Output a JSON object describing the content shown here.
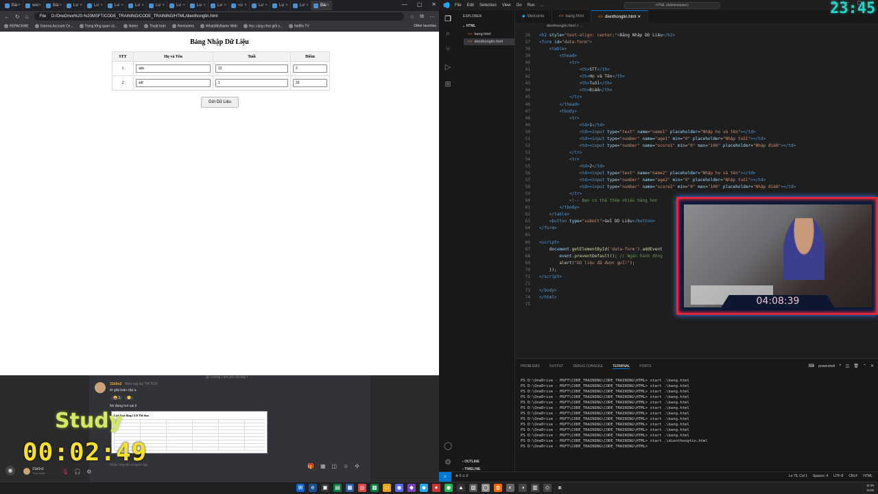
{
  "browser": {
    "tabs": [
      {
        "label": "Bài"
      },
      {
        "label": "wei"
      },
      {
        "label": "Bài"
      },
      {
        "label": "Lư"
      },
      {
        "label": "Lư"
      },
      {
        "label": "Lư"
      },
      {
        "label": "Lư"
      },
      {
        "label": "Lư"
      },
      {
        "label": "Lư"
      },
      {
        "label": "Lư"
      },
      {
        "label": "Lư"
      },
      {
        "label": "<o"
      },
      {
        "label": "Lư"
      },
      {
        "label": "Lư"
      },
      {
        "label": "Lư"
      },
      {
        "label": "Bài"
      }
    ],
    "file_chip": "File",
    "url": "D:/OneDrive%20-%20MSFT/CODE_TRAINING/CODE_TRAINING/HTML/dienthongtin.html",
    "bookmarks": [
      "REPACKME",
      "Garena Account Ce...",
      "Trang tổng quan củ...",
      "Notes",
      "Thuật toán",
      "Reminders",
      "WhatsMyName Web",
      "Học cùng chơi giỏi s...",
      "Netflix TV"
    ],
    "other_favorites": "Other favorites"
  },
  "page": {
    "title": "Bảng Nhập Dữ Liệu",
    "headers": [
      "STT",
      "Họ và Tên",
      "Tuổi",
      "Điểm"
    ],
    "rows": [
      {
        "stt": "1",
        "name": "ads",
        "age": "12",
        "score": "2"
      },
      {
        "stt": "2",
        "name": "sdf",
        "age": "1",
        "score": "33"
      }
    ],
    "submit_label": "Gửi Dữ Liệu"
  },
  "overlay": {
    "chat_cut": "@ Lường Làm pro cái này r",
    "chat_user": "31b0n3",
    "chat_time": "Hôm nay lúc TH:TCH",
    "chat_msg1": "tớ giải toán cậu a",
    "reactions": [
      "😄 1",
      "😁"
    ],
    "chat_msg2": "Nó đang hơi sai tí",
    "chat_img_title": "Lịch hoạt động CLB Thể thao",
    "chat_input_placeholder": "Nhắn #ng-đố-chuyên-tập",
    "study_label": "Study",
    "study_clock": "00:02:49",
    "bottom_user": "31b0n3",
    "bottom_status": "Trực tuyến"
  },
  "vscode": {
    "menu": [
      "File",
      "Edit",
      "Selection",
      "View",
      "Go",
      "Run",
      "..."
    ],
    "command_center": "HTML (Administrator)",
    "explorer_title": "EXPLORER",
    "folder": "HTML",
    "files": [
      "bang.html",
      "dienthongtin.html"
    ],
    "outline": "OUTLINE",
    "timeline": "TIMELINE",
    "tabs": [
      "Welcome",
      "bang.html",
      "dienthongtin.html"
    ],
    "breadcrumb": "dienthongtin.html > ...",
    "code_lines": [
      {
        "n": "36",
        "html": "<span class='tg'>&lt;h2</span> <span class='at'>style</span>=<span class='st'>\"text-align: center;\"</span><span class='tg'>&gt;</span><span class='tx'>Bảng Nhập Dữ Liệu</span><span class='tg'>&lt;/h2&gt;</span>"
      },
      {
        "n": "37",
        "html": "<span class='tg'>&lt;form</span> <span class='at'>id</span>=<span class='st'>\"data-form\"</span><span class='tg'>&gt;</span>"
      },
      {
        "n": "38",
        "html": "    <span class='tg'>&lt;table&gt;</span>"
      },
      {
        "n": "39",
        "html": "        <span class='tg'>&lt;thead&gt;</span>"
      },
      {
        "n": "40",
        "html": "            <span class='tg'>&lt;tr&gt;</span>"
      },
      {
        "n": "41",
        "html": "                <span class='tg'>&lt;th&gt;</span><span class='tx'>STT</span><span class='tg'>&lt;/th&gt;</span>"
      },
      {
        "n": "42",
        "html": "                <span class='tg'>&lt;th&gt;</span><span class='tx'>Họ và Tên</span><span class='tg'>&lt;/th&gt;</span>"
      },
      {
        "n": "43",
        "html": "                <span class='tg'>&lt;th&gt;</span><span class='tx'>Tuổi</span><span class='tg'>&lt;/th&gt;</span>"
      },
      {
        "n": "44",
        "html": "                <span class='tg'>&lt;th&gt;</span><span class='tx'>Điểm</span><span class='tg'>&lt;/th&gt;</span>"
      },
      {
        "n": "45",
        "html": "            <span class='tg'>&lt;/tr&gt;</span>"
      },
      {
        "n": "46",
        "html": "        <span class='tg'>&lt;/thead&gt;</span>"
      },
      {
        "n": "47",
        "html": "        <span class='tg'>&lt;tbody&gt;</span>"
      },
      {
        "n": "48",
        "html": "            <span class='tg'>&lt;tr&gt;</span>"
      },
      {
        "n": "49",
        "html": "                <span class='tg'>&lt;td&gt;</span><span class='tx'>1</span><span class='tg'>&lt;/td&gt;</span>"
      },
      {
        "n": "50",
        "html": "                <span class='tg'>&lt;td&gt;&lt;input</span> <span class='at'>type</span>=<span class='st'>\"text\"</span> <span class='at'>name</span>=<span class='st'>\"name1\"</span> <span class='at'>placeholder</span>=<span class='st'>\"Nhập họ và tên\"</span><span class='tg'>&gt;&lt;/td&gt;</span>"
      },
      {
        "n": "51",
        "html": "                <span class='tg'>&lt;td&gt;&lt;input</span> <span class='at'>type</span>=<span class='st'>\"number\"</span> <span class='at'>name</span>=<span class='st'>\"age1\"</span> <span class='at'>min</span>=<span class='st'>\"0\"</span> <span class='at'>placeholder</span>=<span class='st'>\"Nhập tuổi\"</span><span class='tg'>&gt;&lt;/td&gt;</span>"
      },
      {
        "n": "52",
        "html": "                <span class='tg'>&lt;td&gt;&lt;input</span> <span class='at'>type</span>=<span class='st'>\"number\"</span> <span class='at'>name</span>=<span class='st'>\"score1\"</span> <span class='at'>min</span>=<span class='st'>\"0\"</span> <span class='at'>max</span>=<span class='st'>\"100\"</span> <span class='at'>placeholder</span>=<span class='st'>\"Nhập điểm\"</span><span class='tg'>&gt;&lt;/td&gt;</span>"
      },
      {
        "n": "53",
        "html": "            <span class='tg'>&lt;/tr&gt;</span>"
      },
      {
        "n": "54",
        "html": "            <span class='tg'>&lt;tr&gt;</span>"
      },
      {
        "n": "55",
        "html": "                <span class='tg'>&lt;td&gt;</span><span class='tx'>2</span><span class='tg'>&lt;/td&gt;</span>"
      },
      {
        "n": "56",
        "html": "                <span class='tg'>&lt;td&gt;&lt;input</span> <span class='at'>type</span>=<span class='st'>\"text\"</span> <span class='at'>name</span>=<span class='st'>\"name2\"</span> <span class='at'>placeholder</span>=<span class='st'>\"Nhập họ và tên\"</span><span class='tg'>&gt;&lt;/td&gt;</span>"
      },
      {
        "n": "57",
        "html": "                <span class='tg'>&lt;td&gt;&lt;input</span> <span class='at'>type</span>=<span class='st'>\"number\"</span> <span class='at'>name</span>=<span class='st'>\"age2\"</span> <span class='at'>min</span>=<span class='st'>\"0\"</span> <span class='at'>placeholder</span>=<span class='st'>\"Nhập tuổi\"</span><span class='tg'>&gt;&lt;/td&gt;</span>"
      },
      {
        "n": "58",
        "html": "                <span class='tg'>&lt;td&gt;&lt;input</span> <span class='at'>type</span>=<span class='st'>\"number\"</span> <span class='at'>name</span>=<span class='st'>\"score2\"</span> <span class='at'>min</span>=<span class='st'>\"0\"</span> <span class='at'>max</span>=<span class='st'>\"100\"</span> <span class='at'>placeholder</span>=<span class='st'>\"Nhập điểm\"</span><span class='tg'>&gt;&lt;/td&gt;</span>"
      },
      {
        "n": "59",
        "html": "            <span class='tg'>&lt;/tr&gt;</span>"
      },
      {
        "n": "60",
        "html": "            <span class='cm'>&lt;!-- Bạn có thể thêm nhiều hàng hơn</span>"
      },
      {
        "n": "61",
        "html": "        <span class='tg'>&lt;/tbody&gt;</span>"
      },
      {
        "n": "62",
        "html": "    <span class='tg'>&lt;/table&gt;</span>"
      },
      {
        "n": "63",
        "html": "    <span class='tg'>&lt;button</span> <span class='at'>type</span>=<span class='st'>\"submit\"</span><span class='tg'>&gt;</span><span class='tx'>Gửi Dữ Liệu</span><span class='tg'>&lt;/button&gt;</span>"
      },
      {
        "n": "64",
        "html": "<span class='tg'>&lt;/form&gt;</span>"
      },
      {
        "n": "65",
        "html": ""
      },
      {
        "n": "66",
        "html": "<span class='tg'>&lt;script&gt;</span>"
      },
      {
        "n": "67",
        "html": "    <span class='at'>document</span>.<span class='fn'>getElementById</span>(<span class='st'>'data-form'</span>).<span class='fn'>addEvent</span>"
      },
      {
        "n": "68",
        "html": "        <span class='at'>event</span>.<span class='fn'>preventDefault</span>(); <span class='cm'>// Ngăn hành động</span>"
      },
      {
        "n": "69",
        "html": "        <span class='fn'>alert</span>(<span class='st'>\"Dữ liệu đã được gửi!\"</span>);"
      },
      {
        "n": "70",
        "html": "    });"
      },
      {
        "n": "71",
        "html": "<span class='tg'>&lt;/script&gt;</span>"
      },
      {
        "n": "72",
        "html": ""
      },
      {
        "n": "73",
        "html": "<span class='tg'>&lt;/body&gt;</span>"
      },
      {
        "n": "74",
        "html": "<span class='tg'>&lt;/html&gt;</span>"
      },
      {
        "n": "75",
        "html": ""
      }
    ],
    "panel_tabs": [
      "PROBLEMS",
      "OUTPUT",
      "DEBUG CONSOLE",
      "TERMINAL",
      "PORTS"
    ],
    "panel_active": "TERMINAL",
    "shell": "powershell",
    "terminal_lines": [
      "PS D:\\OneDrive - MSFT\\CODE_TRAINING\\CODE_TRAINING\\HTML> start .\\bang.html",
      "PS D:\\OneDrive - MSFT\\CODE_TRAINING\\CODE_TRAINING\\HTML> start .\\bang.html",
      "PS D:\\OneDrive - MSFT\\CODE_TRAINING\\CODE_TRAINING\\HTML> start .\\bang.html",
      "PS D:\\OneDrive - MSFT\\CODE_TRAINING\\CODE_TRAINING\\HTML> start .\\bang.html",
      "PS D:\\OneDrive - MSFT\\CODE_TRAINING\\CODE_TRAINING\\HTML> start .\\bang.html",
      "PS D:\\OneDrive - MSFT\\CODE_TRAINING\\CODE_TRAINING\\HTML> start .\\bang.html",
      "PS D:\\OneDrive - MSFT\\CODE_TRAINING\\CODE_TRAINING\\HTML> start .\\bang.html",
      "PS D:\\OneDrive - MSFT\\CODE_TRAINING\\CODE_TRAINING\\HTML> start .\\bang.html",
      "PS D:\\OneDrive - MSFT\\CODE_TRAINING\\CODE_TRAINING\\HTML> start .\\bang.html",
      "PS D:\\OneDrive - MSFT\\CODE_TRAINING\\CODE_TRAINING\\HTML> start .\\bang.html",
      "PS D:\\OneDrive - MSFT\\CODE_TRAINING\\CODE_TRAINING\\HTML> start .\\bang.html",
      "PS D:\\OneDrive - MSFT\\CODE_TRAINING\\CODE_TRAINING\\HTML> start .\\dienthongtin.html",
      "PS D:\\OneDrive - MSFT\\CODE_TRAINING\\CODE_TRAINING\\HTML> "
    ],
    "status_left": "⊗ 0 ⚠ 0",
    "status_right": [
      "Ln 75, Col 1",
      "Spaces: 4",
      "UTF-8",
      "CRLF",
      "HTML"
    ]
  },
  "top_clock": "23:45",
  "webcam_timer": "04:08:39",
  "tray": {
    "time": "11:45",
    "date": "11/26"
  },
  "colors": {
    "vscode_accent": "#0078d4",
    "study_clock": "#f5e02b",
    "top_clock": "#22d6c8",
    "webcam_border": "#e0283a"
  }
}
